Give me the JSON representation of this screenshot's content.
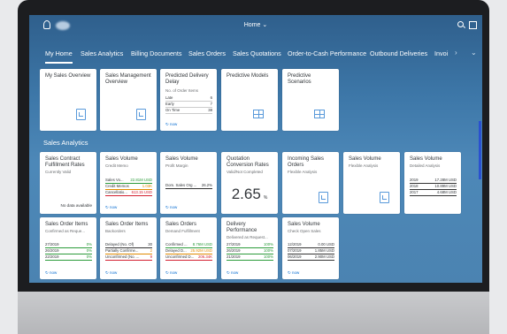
{
  "shell": {
    "title": "Home ⌄"
  },
  "tabs": [
    "My Home",
    "Sales Analytics",
    "Billing Documents",
    "Sales Orders",
    "Sales Quotations",
    "Order-to-Cash Performance",
    "Outbound Deliveries",
    "Invoi"
  ],
  "tab_arrows": {
    "next": "›",
    "more": "⌄"
  },
  "home_tiles": [
    {
      "title": "My Sales Overview"
    },
    {
      "title": "Sales Management Overview"
    },
    {
      "title": "Predicted Delivery Delay",
      "subtitle": "No. of Order Items",
      "rows": [
        {
          "l": "Late",
          "v": "6"
        },
        {
          "l": "Early",
          "v": "7"
        },
        {
          "l": "On Time",
          "v": "38"
        }
      ],
      "footer": "now"
    },
    {
      "title": "Predictive Models"
    },
    {
      "title": "Predictive Scenarios"
    }
  ],
  "section_title": "Sales Analytics",
  "analytics_row1": [
    {
      "title": "Sales Contract Fulfillment Rates",
      "subtitle": "Currently Valid",
      "note": "No data available"
    },
    {
      "title": "Sales Volume",
      "subtitle": "Credit Memo",
      "rows": [
        {
          "l": "Sales Vo...",
          "v": "22.81M USD"
        },
        {
          "l": "Credit Memos",
          "v": "1.03K"
        },
        {
          "l": "Cancellatio...",
          "v": "613.15 USD"
        }
      ],
      "footer": "now"
    },
    {
      "title": "Sales Volume",
      "subtitle": "Profit Margin",
      "rows": [
        {
          "l": "Dom. Sales Org ...",
          "v": "26.2%"
        }
      ],
      "footer": "now"
    },
    {
      "title": "Quotation Conversion Rates",
      "subtitle": "Valid/Not Completed",
      "kpi": "2.65",
      "unit": "%"
    },
    {
      "title": "Incoming Sales Orders",
      "subtitle": "Flexible Analysis"
    },
    {
      "title": "Sales Volume",
      "subtitle": "Flexible Analysis"
    },
    {
      "title": "Sales Volume",
      "subtitle": "Detailed Analysis",
      "rows": [
        {
          "l": "2019",
          "v": "17.28M USD"
        },
        {
          "l": "2018",
          "v": "10.89M USD"
        },
        {
          "l": "2017",
          "v": "4.68M USD"
        }
      ]
    }
  ],
  "analytics_row2": [
    {
      "title": "Sales Order Items",
      "subtitle": "Confirmed as Reque...",
      "rows": [
        {
          "l": "27/2019",
          "v": "0%"
        },
        {
          "l": "26/2019",
          "v": "0%"
        },
        {
          "l": "22/2019",
          "v": "0%"
        }
      ],
      "footer": "now"
    },
    {
      "title": "Sales Order Items",
      "subtitle": "Backorders",
      "rows": [
        {
          "l": "Delayed (No. Of)",
          "v": "30"
        },
        {
          "l": "Partially Confirme...",
          "v": "2"
        },
        {
          "l": "Unconfirmed (No. ...",
          "v": "9"
        }
      ],
      "footer": "now"
    },
    {
      "title": "Sales Orders",
      "subtitle": "Demand Fulfillment",
      "rows": [
        {
          "l": "Confirmed ...",
          "v": "8.76M USD"
        },
        {
          "l": "Delayed D...",
          "v": "25.92M USD"
        },
        {
          "l": "Unconfirmed D...",
          "v": "206.34K"
        }
      ],
      "footer": "now"
    },
    {
      "title": "Delivery Performance",
      "subtitle": "Delivered as Request...",
      "rows": [
        {
          "l": "27/2019",
          "v": "100%"
        },
        {
          "l": "26/2019",
          "v": "100%"
        },
        {
          "l": "21/2019",
          "v": "100%"
        }
      ],
      "footer": "now"
    },
    {
      "title": "Sales Volume",
      "subtitle": "Check Open Sales",
      "rows": [
        {
          "l": "12/2019",
          "v": "0.00 USD"
        },
        {
          "l": "07/2019",
          "v": "1.85M USD"
        },
        {
          "l": "06/2019",
          "v": "2.90M USD"
        }
      ],
      "footer": "now"
    }
  ],
  "footer_prefix": "↻"
}
